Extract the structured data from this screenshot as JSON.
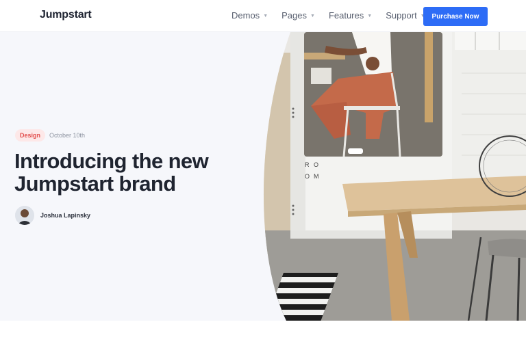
{
  "header": {
    "brand": "Jumpstart",
    "nav": [
      {
        "label": "Demos"
      },
      {
        "label": "Pages"
      },
      {
        "label": "Features"
      },
      {
        "label": "Support"
      }
    ],
    "cta_label": "Purchase Now",
    "accent": "#2d6cf6"
  },
  "hero": {
    "tag": "Design",
    "date": "October 10th",
    "title_line1": "Introducing the new",
    "title_line2": "Jumpstart brand",
    "author_name": "Joshua Lapinsky",
    "image_sign": [
      "R",
      "O",
      "O",
      "M"
    ]
  }
}
